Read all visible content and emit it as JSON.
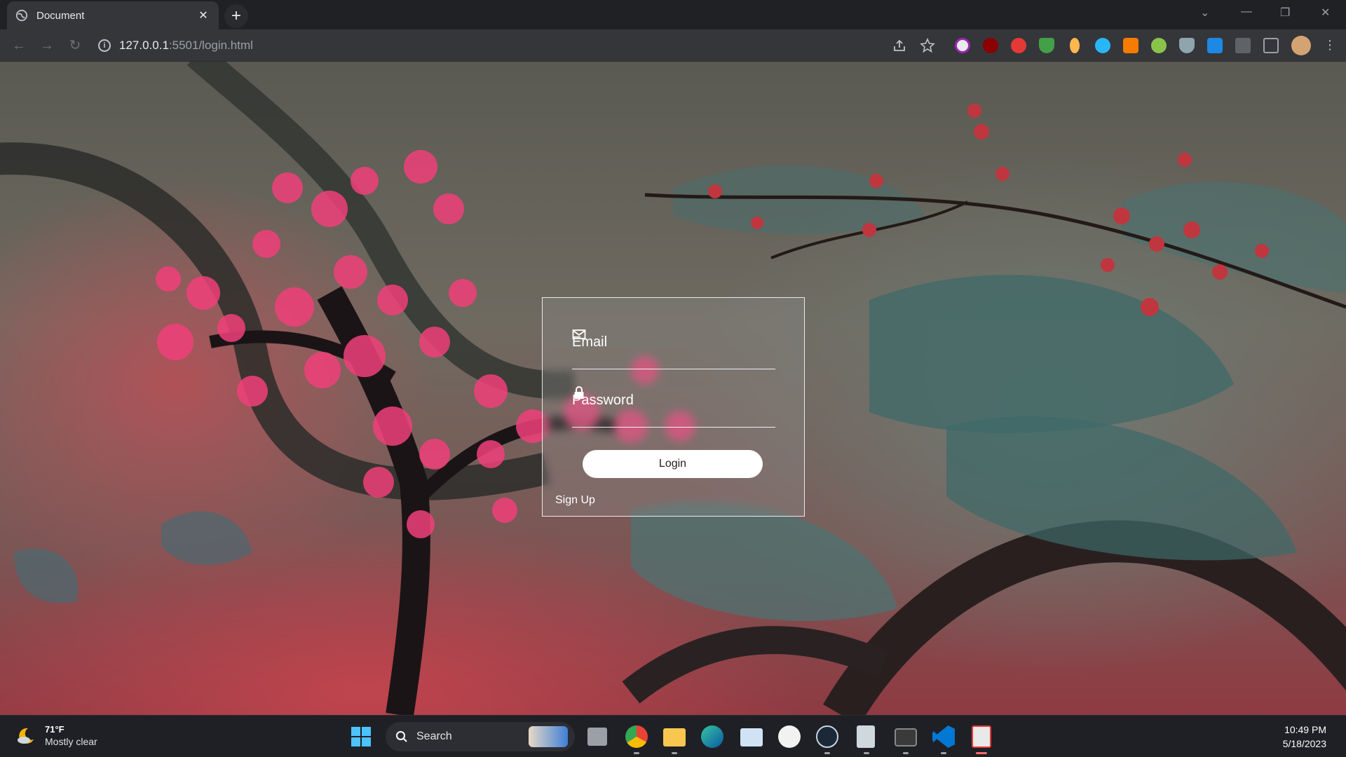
{
  "browser": {
    "tab_title": "Document",
    "address_host": "127.0.0.1",
    "address_path": ":5501/login.html",
    "extensions": [
      "ublock-icon",
      "abp-icon",
      "shield-icon",
      "metamask-icon",
      "puzzle-icon"
    ]
  },
  "login": {
    "email_label": "Email",
    "password_label": "Password",
    "login_button": "Login",
    "signup_link": "Sign Up"
  },
  "taskbar": {
    "weather_temp": "71°F",
    "weather_condition": "Mostly clear",
    "search_label": "Search",
    "time": "10:49 PM",
    "date": "5/18/2023"
  }
}
